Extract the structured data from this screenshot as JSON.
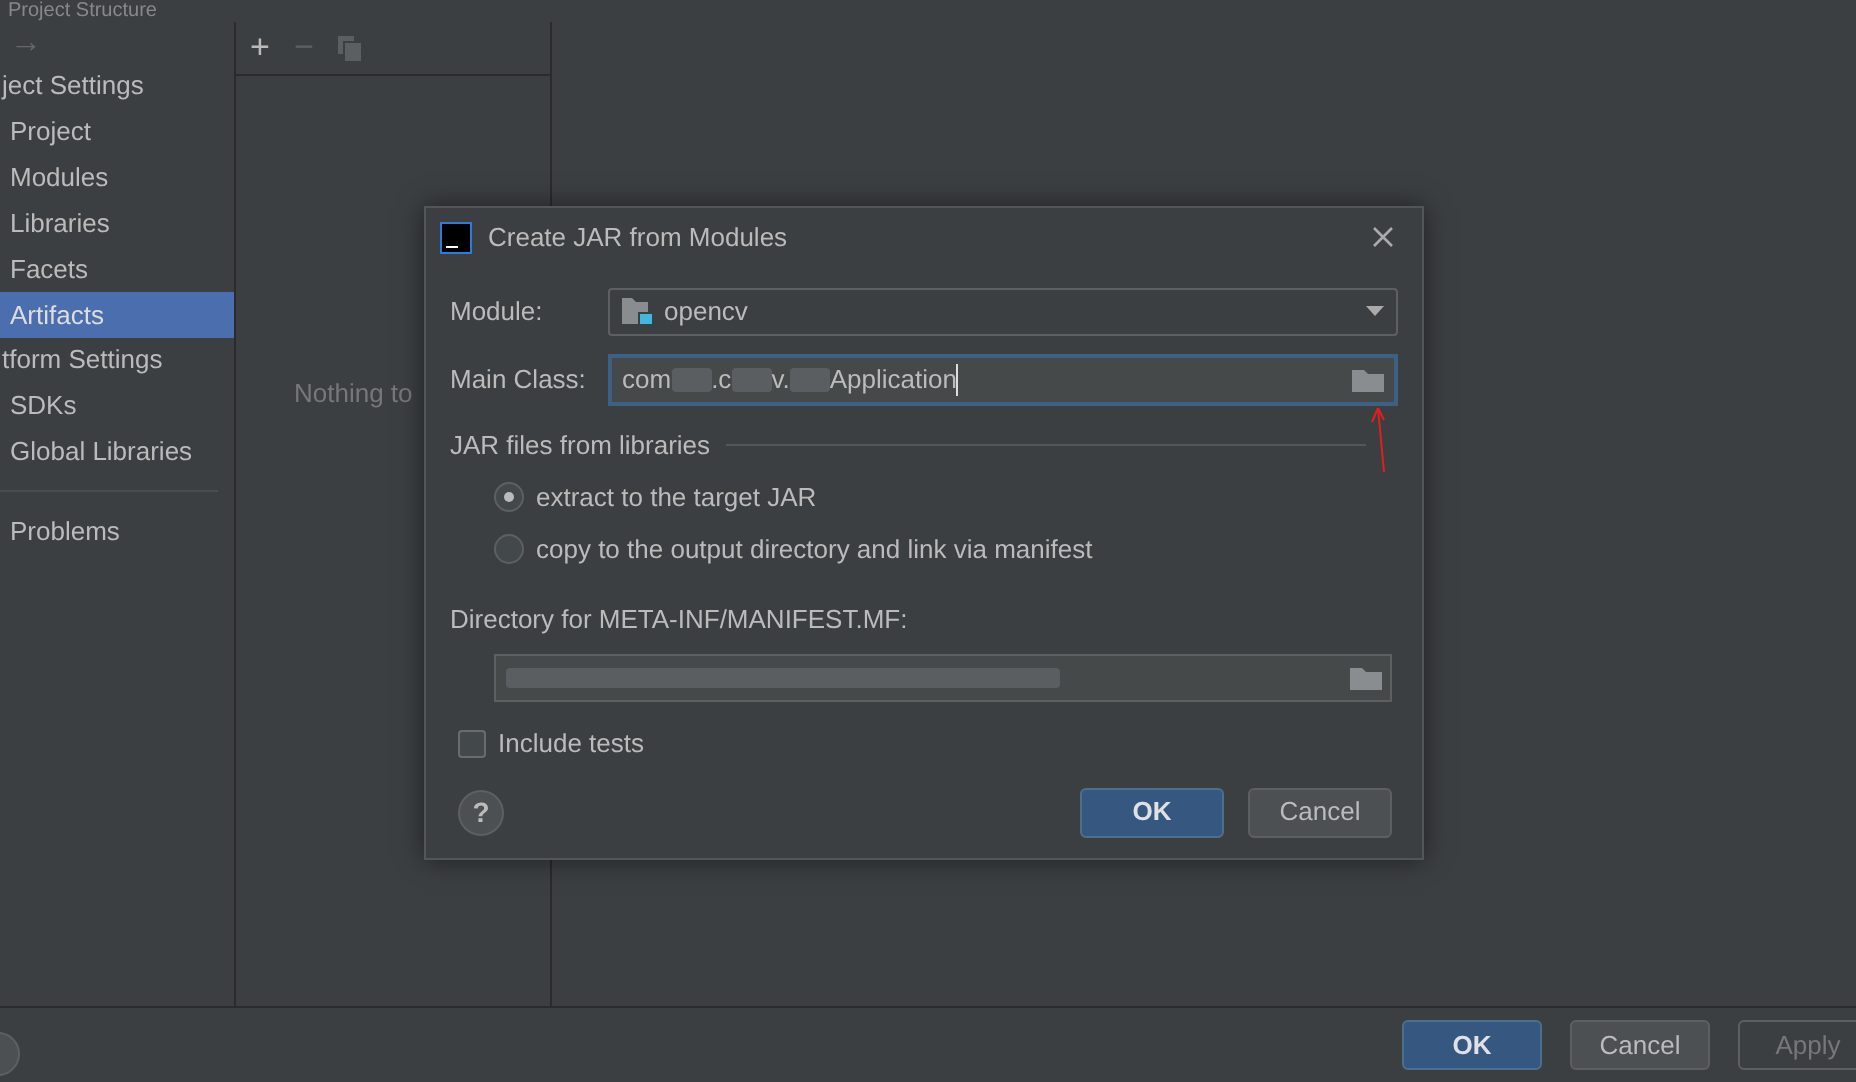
{
  "window": {
    "title": "Project Structure"
  },
  "nav": {
    "back_arrow": "→"
  },
  "sidebar": {
    "sections": [
      {
        "header": "ject Settings",
        "items": [
          {
            "label": "Project",
            "selected": false
          },
          {
            "label": "Modules",
            "selected": false
          },
          {
            "label": "Libraries",
            "selected": false
          },
          {
            "label": "Facets",
            "selected": false
          },
          {
            "label": "Artifacts",
            "selected": true
          }
        ]
      },
      {
        "header": "tform Settings",
        "items": [
          {
            "label": "SDKs",
            "selected": false
          },
          {
            "label": "Global Libraries",
            "selected": false
          }
        ]
      }
    ],
    "footer_items": [
      {
        "label": "Problems",
        "selected": false
      }
    ]
  },
  "middle_panel": {
    "toolbar": [
      "+",
      "−"
    ],
    "empty_text": "Nothing to"
  },
  "dialog": {
    "title": "Create JAR from Modules",
    "module_label": "Module:",
    "module_value": "opencv",
    "main_class_label": "Main Class:",
    "main_class_parts": [
      {
        "kind": "text",
        "text": "com"
      },
      {
        "kind": "blur"
      },
      {
        "kind": "text",
        "text": ".c"
      },
      {
        "kind": "blur"
      },
      {
        "kind": "text",
        "text": "v."
      },
      {
        "kind": "blur"
      },
      {
        "kind": "text",
        "text": "Application"
      }
    ],
    "section_title": "JAR files from libraries",
    "options": [
      {
        "label": "extract to the target JAR",
        "selected": true
      },
      {
        "label": "copy to the output directory and link via manifest",
        "selected": false
      }
    ],
    "directory_label": "Directory for META-INF/MANIFEST.MF:",
    "include_tests": {
      "label": "Include tests",
      "checked": false
    },
    "help": "?",
    "buttons": [
      {
        "label": "OK",
        "kind": "primary"
      },
      {
        "label": "Cancel",
        "kind": "secondary"
      }
    ]
  },
  "footer": {
    "buttons": [
      {
        "label": "OK",
        "kind": "primary"
      },
      {
        "label": "Cancel",
        "kind": "secondary"
      },
      {
        "label": "Apply",
        "kind": "disabled"
      }
    ]
  }
}
